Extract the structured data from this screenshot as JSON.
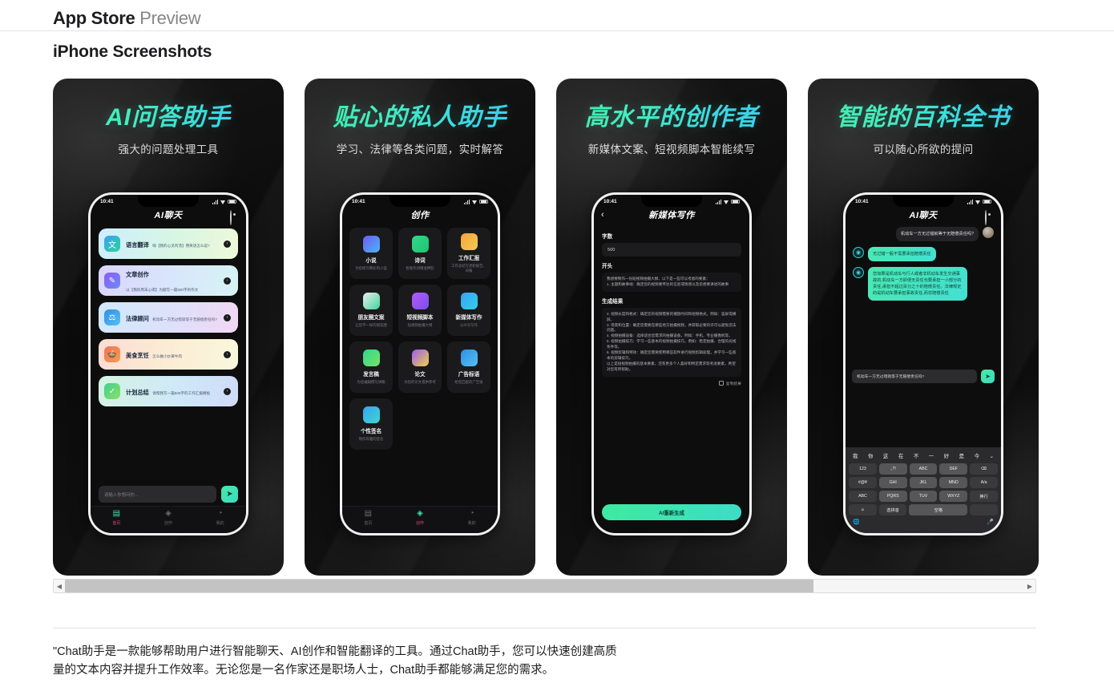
{
  "header": {
    "brand_bold": "App Store",
    "brand_light": "Preview",
    "section_title": "iPhone Screenshots"
  },
  "accent": {
    "mint": "#3eeaa0",
    "cyan": "#3bc8f0",
    "pink": "#e6467a"
  },
  "scrollbar": {
    "left_arrow": "◀",
    "right_arrow": "▶"
  },
  "shots": [
    {
      "title": "AI问答助手",
      "subtitle": "强大的问题处理工具",
      "status_time": "10:41",
      "app_bar_title": "AI聊天",
      "cards": [
        {
          "icon": "translate-icon",
          "glyph": "文A",
          "title": "语言翻译",
          "desc": "嗨【我的心灵鸡汤】用英语怎么说?"
        },
        {
          "icon": "pencil-icon",
          "glyph": "✎",
          "title": "文章创作",
          "desc": "以【我的周末心得】为题写一篇500字的作文"
        },
        {
          "icon": "law-icon",
          "glyph": "⚖",
          "title": "法律顾问",
          "desc": "机动车一方无过错就等于无赔偿责任吗?"
        },
        {
          "icon": "food-icon",
          "glyph": "🍲",
          "title": "美食烹饪",
          "desc": "怎么做小炒黄牛肉"
        },
        {
          "icon": "plan-icon",
          "glyph": "✓",
          "title": "计划总结",
          "desc": "请帮我写一篇500字的工作汇报模板"
        }
      ],
      "input_placeholder": "请输入你想问的…",
      "send_icon": "send-icon",
      "tabs": [
        {
          "icon": "home-icon",
          "label": "首页",
          "active": true
        },
        {
          "icon": "create-icon",
          "label": "创作",
          "active": false
        },
        {
          "icon": "profile-icon",
          "label": "我的",
          "active": false
        }
      ]
    },
    {
      "title": "贴心的私人助手",
      "subtitle": "学习、法律等各类问题，实时解答",
      "status_time": "10:41",
      "app_bar_title": "创作",
      "grid": [
        {
          "title": "小说",
          "desc": "为您续写精彩的小说"
        },
        {
          "title": "诗词",
          "desc": "智能作诗精准押韵"
        },
        {
          "title": "工作汇报",
          "desc": "工作总结写述职报告、日报"
        },
        {
          "title": "朋友圈文案",
          "desc": "让您不一样的朋友圈"
        },
        {
          "title": "短视频脚本",
          "desc": "短视频拍摄大纲"
        },
        {
          "title": "新媒体写作",
          "desc": "公众号写作"
        },
        {
          "title": "发言稿",
          "desc": "为您编辑撰写讲稿"
        },
        {
          "title": "论文",
          "desc": "为您的论文提供参考"
        },
        {
          "title": "广告标语",
          "desc": "给您匹配的广告语"
        },
        {
          "title": "个性签名",
          "desc": "制作有趣的签名"
        }
      ],
      "tabs": [
        {
          "icon": "home-icon",
          "label": "首页",
          "active": false
        },
        {
          "icon": "create-icon",
          "label": "创作",
          "active": true
        },
        {
          "icon": "profile-icon",
          "label": "我的",
          "active": false
        }
      ]
    },
    {
      "title": "高水平的创作者",
      "subtitle": "新媒体文案、短视频脚本智能续写",
      "status_time": "10:41",
      "app_bar_title": "新媒体写作",
      "back_icon": "back-chevron-icon",
      "form": {
        "count_label": "字数",
        "count_value": "500",
        "opening_label": "开头",
        "opening_text": "我想要制作一份短视频拍摄大纲，以下是一些可以考虑的要素：\n1. 主题和故事线：确定您的视频要传达的信息或情感以及您想要讲述的故事",
        "result_label": "生成结果",
        "result_text": "2. 视频长度和格式：确定您的视频需要的播放时间和视频格式，例如：竖屏或横屏。\n3. 场景和位置：确定您需要在哪些地方拍摄视频，并获取必要的许可以避免违法问题。\n4. 视频拍摄设备：选择适合您需求的拍摄设备，例如：手机、专业摄像机等。\n5. 视频拍摄技巧：学习一些基本的视频拍摄技巧，例如：稳定拍摄、合理的光线条件等。\n6. 视频剪辑和特效：确定您需要使用哪些软件进行视频剪辑处理，并学习一些基本的剪辑技巧。\n以上是短视频拍摄的基本要素，还有更多个人喜好和特定需求等考虑要素，希望对您有所帮助。",
        "copy_label": "复制结果",
        "copy_icon": "copy-icon",
        "regen_label": "AI重新生成"
      }
    },
    {
      "title": "智能的百科全书",
      "subtitle": "可以随心所欲的提问",
      "status_time": "10:41",
      "app_bar_title": "AI聊天",
      "messages": [
        {
          "from": "user",
          "text": "机动车一方无过错就等于无赔偿责任吗?"
        },
        {
          "from": "bot",
          "text": "无过错一般不需要承担赔偿责任"
        },
        {
          "from": "bot",
          "text": "您如果是机动车与行人或者非机动车发生交通事故的,机动车一方即便无责任也要承担一小部分的责任,承担不超过百分之十的赔偿责任。法律规定的是机动车要承担事故责任,而非赔偿责任"
        }
      ],
      "input_value": "机动车一方无过错就等于无赔偿责任吗?",
      "send_icon": "send-icon",
      "keyboard": {
        "suggestions": [
          "我",
          "你",
          "这",
          "在",
          "不",
          "一",
          "好",
          "是",
          "今"
        ],
        "collapse_icon": "chevron-down-icon",
        "rows": [
          [
            "123",
            ".,?!",
            "ABC",
            "DEF",
            "⌫"
          ],
          [
            "#@¥",
            "GHI",
            "JKL",
            "MNO",
            "A/a"
          ],
          [
            "ABC",
            "PQRS",
            "TUV",
            "WXYZ",
            "换行"
          ],
          [
            "☺",
            "选拼音",
            "空格"
          ]
        ],
        "globe_icon": "globe-icon",
        "mic_icon": "mic-icon"
      }
    }
  ],
  "description": {
    "quote_mark": "\"",
    "line1": "Chat助手是一款能够帮助用户进行智能聊天、AI创作和智能翻译的工具。通过Chat助手，您可以快速创建高质",
    "line2": "量的文本内容并提升工作效率。无论您是一名作家还是职场人士，Chat助手都能够满足您的需求。"
  }
}
